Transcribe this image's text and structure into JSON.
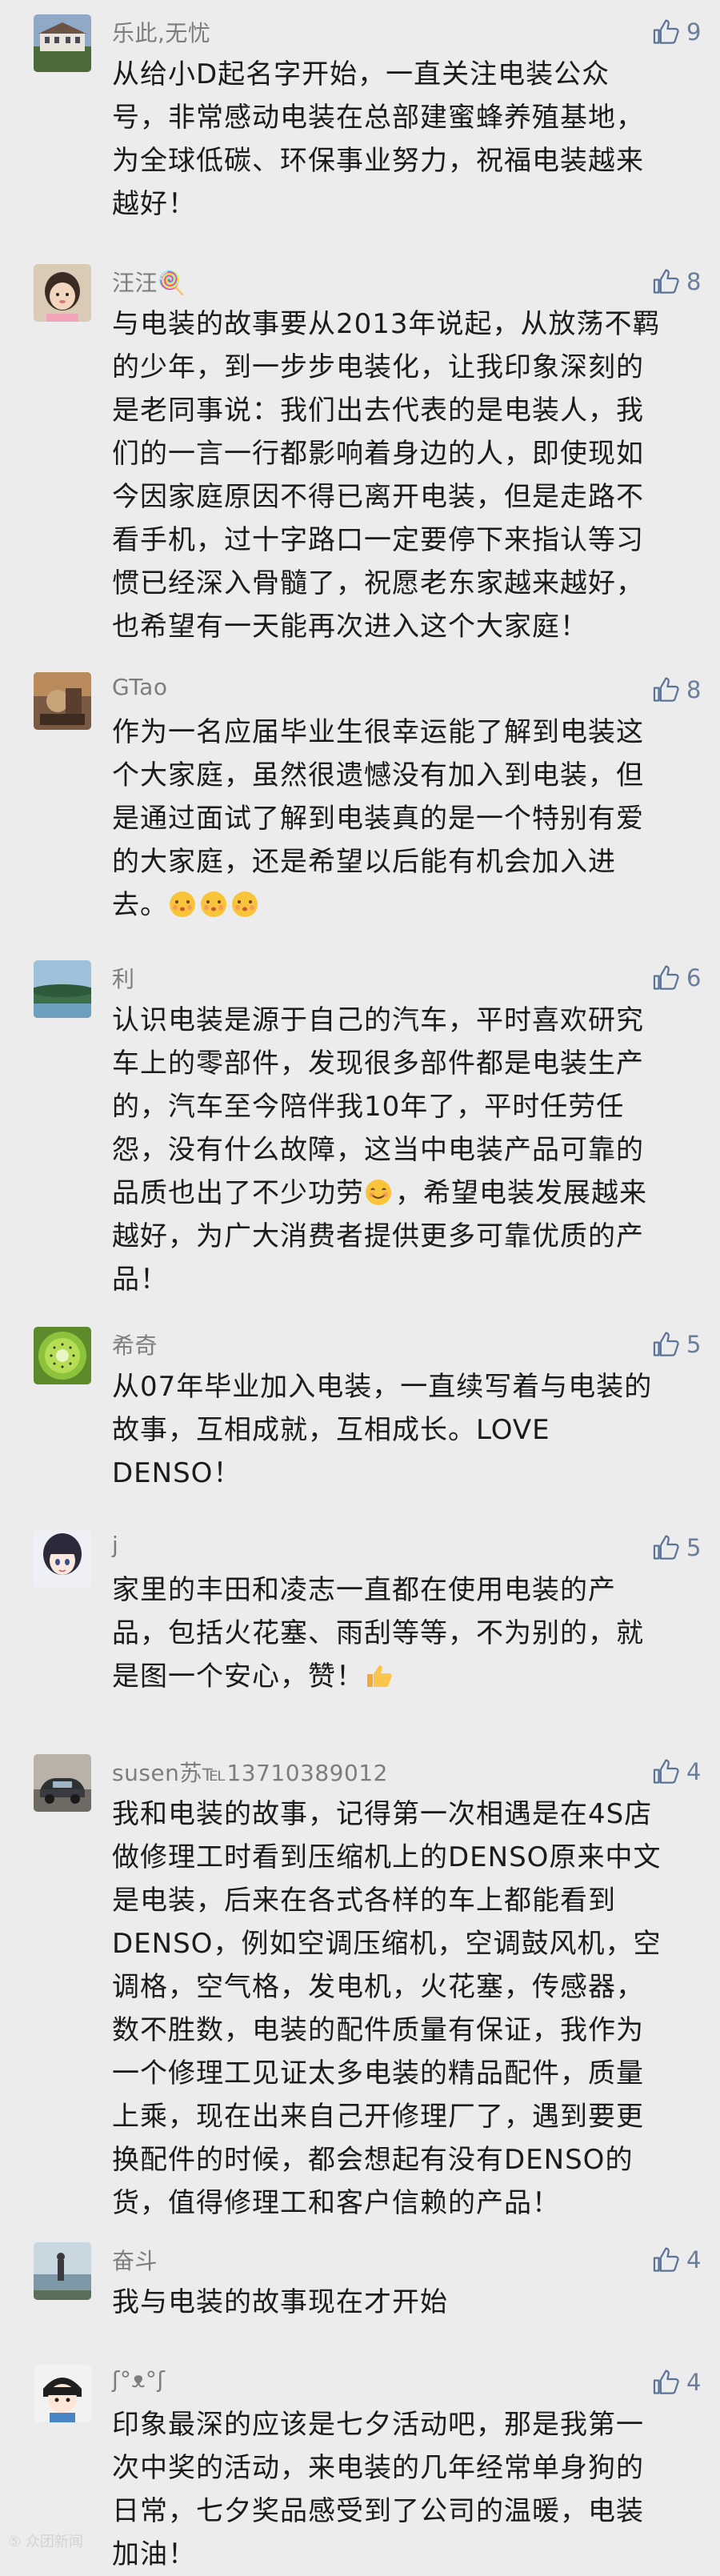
{
  "comments": [
    {
      "user": "乐此,无忧",
      "likes": "9",
      "avatar": "building-photo-avatar",
      "lines": [
        "从给小D起名字开始，一直关注电装公众",
        "号，非常感动电装在总部建蜜蜂养殖基地，",
        "为全球低碳、环保事业努力，祝福电装越来",
        "越好！"
      ]
    },
    {
      "user": "汪汪🍭",
      "likes": "8",
      "avatar": "child-photo-avatar",
      "lines": [
        "与电装的故事要从2013年说起，从放荡不羁",
        "的少年，到一步步电装化，让我印象深刻的",
        "是老同事说：我们出去代表的是电装人，我",
        "们的一言一行都影响着身边的人，即使现如",
        "今因家庭原因不得已离开电装，但是走路不",
        "看手机，过十字路口一定要停下来指认等习",
        "惯已经深入骨髓了，祝愿老东家越来越好，",
        "也希望有一天能再次进入这个大家庭！"
      ]
    },
    {
      "user": "GTao",
      "likes": "8",
      "avatar": "artwork-avatar",
      "lines": [
        "作为一名应届毕业生很幸运能了解到电装这",
        "个大家庭，虽然很遗憾没有加入到电装，但",
        "是通过面试了解到电装真的是一个特别有爱",
        "的大家庭，还是希望以后能有机会加入进",
        "去。"
      ]
    },
    {
      "user": "利",
      "likes": "6",
      "avatar": "landscape-avatar",
      "lines": [
        "认识电装是源于自己的汽车，平时喜欢研究",
        "车上的零部件，发现很多部件都是电装生产",
        "的，汽车至今陪伴我10年了，平时任劳任",
        "怨，没有什么故障，这当中电装产品可靠的",
        "品质也出了不少功劳",
        "，希望电装发展越来",
        "越好，为广大消费者提供更多可靠优质的产",
        "品！"
      ]
    },
    {
      "user": "希奇",
      "likes": "5",
      "avatar": "kiwi-avatar",
      "lines": [
        "从07年毕业加入电装，一直续写着与电装的",
        "故事，互相成就，互相成长。LOVE",
        "DENSO！"
      ]
    },
    {
      "user": "j",
      "likes": "5",
      "avatar": "anime-girl-avatar",
      "lines": [
        "家里的丰田和凌志一直都在使用电装的产",
        "品，包括火花塞、雨刮等等，不为别的，就",
        "是图一个安心，赞！"
      ]
    },
    {
      "user": "susen苏℡13710389012",
      "likes": "4",
      "avatar": "car-photo-avatar",
      "lines": [
        "我和电装的故事，记得第一次相遇是在4S店",
        "做修理工时看到压缩机上的DENSO原来中文",
        "是电装，后来在各式各样的车上都能看到",
        "DENSO，例如空调压缩机，空调鼓风机，空",
        "调格，空气格，发电机，火花塞，传感器，",
        "数不胜数，电装的配件质量有保证，我作为",
        "一个修理工见证太多电装的精品配件，质量",
        "上乘，现在出来自己开修理厂了，遇到要更",
        "换配件的时候，都会想起有没有DENSO的",
        "货，值得修理工和客户信赖的产品！"
      ]
    },
    {
      "user": "奋斗",
      "likes": "4",
      "avatar": "lakeside-avatar",
      "lines": [
        "我与电装的故事现在才开始"
      ]
    },
    {
      "user": "ʃ°ᴥ°ʃ",
      "likes": "4",
      "avatar": "cartoon-avatar",
      "lines": [
        "印象最深的应该是七夕活动吧，那是我第一",
        "次中奖的活动，来电装的几年经常单身狗的",
        "日常，七夕奖品感受到了公司的温暖，电装",
        "加油！"
      ]
    }
  ],
  "watermark": "⑤ 众团新闻"
}
